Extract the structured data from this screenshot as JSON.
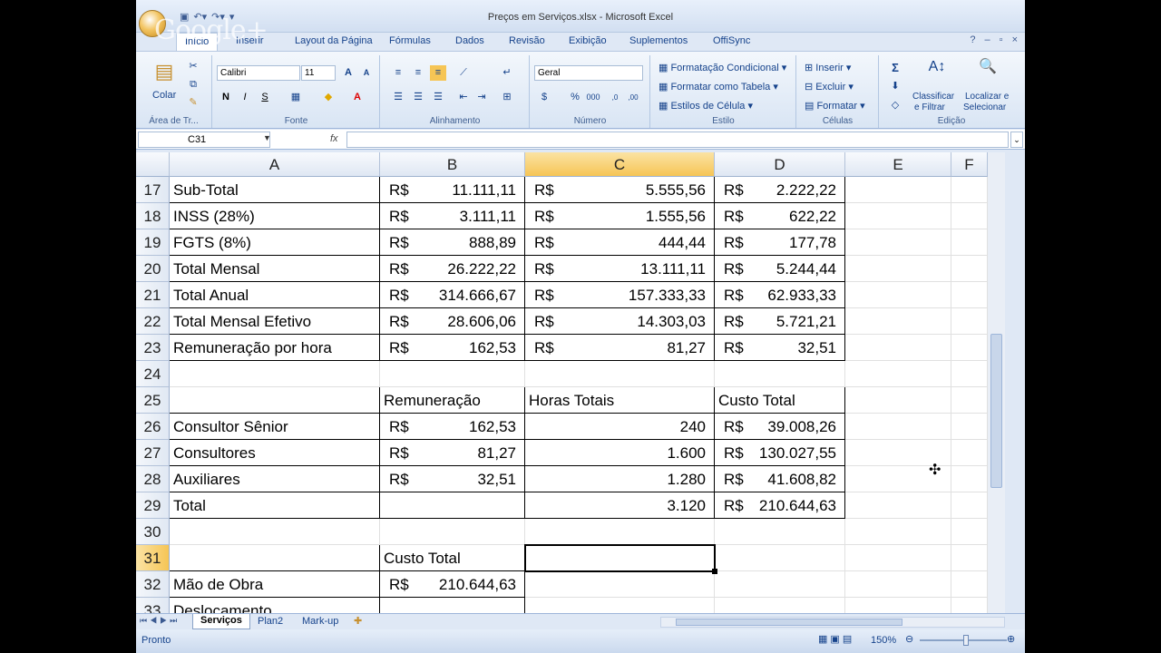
{
  "title": "Preços em Serviços.xlsx - Microsoft Excel",
  "watermark": "Google+",
  "tabs": [
    "Início",
    "Inserir",
    "Layout da Página",
    "Fórmulas",
    "Dados",
    "Revisão",
    "Exibição",
    "Suplementos",
    "OffiSync"
  ],
  "ribbon": {
    "colar": "Colar",
    "font_name": "Calibri",
    "font_size": "11",
    "number_format": "Geral",
    "groups": {
      "clipboard": "Área de Tr...",
      "font": "Fonte",
      "alignment": "Alinhamento",
      "number": "Número",
      "styles": "Estilo",
      "cells": "Células",
      "editing": "Edição"
    },
    "styles": {
      "conditional": "Formatação Condicional",
      "table": "Formatar como Tabela",
      "cell_styles": "Estilos de Célula"
    },
    "cells": {
      "insert": "Inserir",
      "delete": "Excluir",
      "format": "Formatar"
    },
    "editing": {
      "sort1": "Classificar",
      "sort2": "e Filtrar",
      "find1": "Localizar e",
      "find2": "Selecionar"
    },
    "bold": "N",
    "italic": "I",
    "underline": "S"
  },
  "name_box": "C31",
  "fx": "fx",
  "columns": [
    "A",
    "B",
    "C",
    "D",
    "E",
    "F"
  ],
  "rows": [
    {
      "n": "17",
      "a": "Sub-Total",
      "b_cur": "R$",
      "b": "11.111,11",
      "c_cur": "R$",
      "c": "5.555,56",
      "d_cur": "R$",
      "d": "2.222,22"
    },
    {
      "n": "18",
      "a": "INSS (28%)",
      "b_cur": "R$",
      "b": "3.111,11",
      "c_cur": "R$",
      "c": "1.555,56",
      "d_cur": "R$",
      "d": "622,22"
    },
    {
      "n": "19",
      "a": "FGTS (8%)",
      "b_cur": "R$",
      "b": "888,89",
      "c_cur": "R$",
      "c": "444,44",
      "d_cur": "R$",
      "d": "177,78"
    },
    {
      "n": "20",
      "a": "Total Mensal",
      "b_cur": "R$",
      "b": "26.222,22",
      "c_cur": "R$",
      "c": "13.111,11",
      "d_cur": "R$",
      "d": "5.244,44"
    },
    {
      "n": "21",
      "a": "Total Anual",
      "b_cur": "R$",
      "b": "314.666,67",
      "c_cur": "R$",
      "c": "157.333,33",
      "d_cur": "R$",
      "d": "62.933,33"
    },
    {
      "n": "22",
      "a": "Total Mensal Efetivo",
      "b_cur": "R$",
      "b": "28.606,06",
      "c_cur": "R$",
      "c": "14.303,03",
      "d_cur": "R$",
      "d": "5.721,21"
    },
    {
      "n": "23",
      "a": "Remuneração por hora",
      "b_cur": "R$",
      "b": "162,53",
      "c_cur": "R$",
      "c": "81,27",
      "d_cur": "R$",
      "d": "32,51"
    },
    {
      "n": "24",
      "a": "",
      "b_cur": "",
      "b": "",
      "c_cur": "",
      "c": "",
      "d_cur": "",
      "d": ""
    },
    {
      "n": "25",
      "a": "",
      "b_cur": "Remuneração",
      "b": "",
      "c_cur": "Horas Totais",
      "c": "",
      "d_cur": "Custo Total",
      "d": ""
    },
    {
      "n": "26",
      "a": "Consultor Sênior",
      "b_cur": "R$",
      "b": "162,53",
      "c_cur": "",
      "c": "240",
      "d_cur": "R$",
      "d": "39.008,26"
    },
    {
      "n": "27",
      "a": "Consultores",
      "b_cur": "R$",
      "b": "81,27",
      "c_cur": "",
      "c": "1.600",
      "d_cur": "R$",
      "d": "130.027,55"
    },
    {
      "n": "28",
      "a": "Auxiliares",
      "b_cur": "R$",
      "b": "32,51",
      "c_cur": "",
      "c": "1.280",
      "d_cur": "R$",
      "d": "41.608,82"
    },
    {
      "n": "29",
      "a": "Total",
      "b_cur": "",
      "b": "",
      "c_cur": "",
      "c": "3.120",
      "d_cur": "R$",
      "d": "210.644,63"
    },
    {
      "n": "30",
      "a": "",
      "b_cur": "",
      "b": "",
      "c_cur": "",
      "c": "",
      "d_cur": "",
      "d": ""
    },
    {
      "n": "31",
      "a": "",
      "b_cur": "Custo Total",
      "b": "",
      "c_cur": "",
      "c": "",
      "d_cur": "",
      "d": ""
    },
    {
      "n": "32",
      "a": "Mão de Obra",
      "b_cur": "R$",
      "b": "210.644,63",
      "c_cur": "",
      "c": "",
      "d_cur": "",
      "d": ""
    },
    {
      "n": "33",
      "a": "Deslocamento",
      "b_cur": "",
      "b": "",
      "c_cur": "",
      "c": "",
      "d_cur": "",
      "d": ""
    }
  ],
  "sheets": [
    "Serviços",
    "Plan2",
    "Mark-up"
  ],
  "status": {
    "text": "Pronto",
    "zoom": "150%"
  }
}
